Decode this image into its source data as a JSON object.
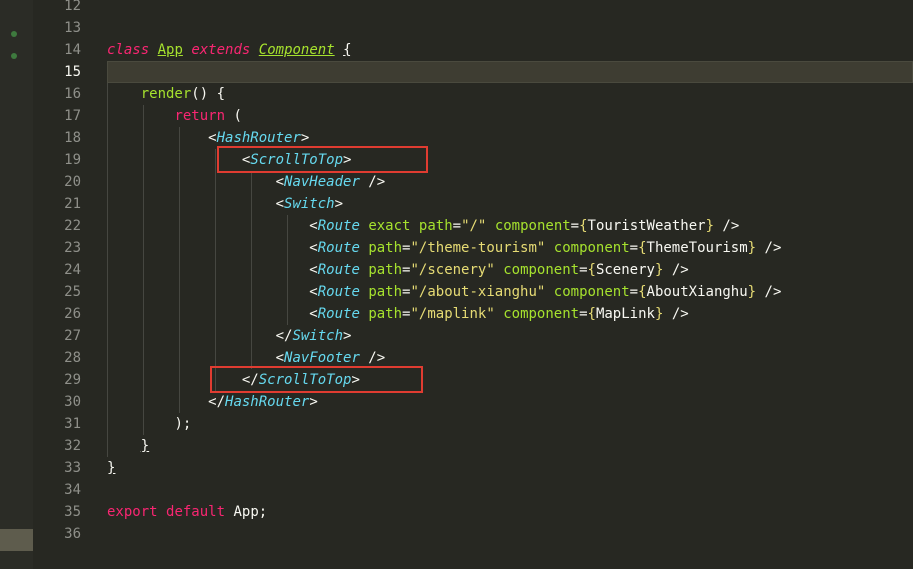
{
  "editor": {
    "theme_colors": {
      "background": "#272822",
      "keyword": "#f92672",
      "tag": "#66d9ef",
      "attribute": "#a6e22e",
      "string": "#e6db74",
      "plain": "#f8f8f2",
      "line_number": "#8f908a",
      "highlight_box": "#e03c31"
    },
    "line_numbers": [
      "12",
      "13",
      "14",
      "15",
      "16",
      "17",
      "18",
      "19",
      "20",
      "21",
      "22",
      "23",
      "24",
      "25",
      "26",
      "27",
      "28",
      "29",
      "30",
      "31",
      "32",
      "33",
      "34",
      "35",
      "36"
    ],
    "active_line": "15",
    "highlighted_lines": [
      "19",
      "29"
    ],
    "code": {
      "l14": {
        "kw_class": "class",
        "name": "App",
        "kw_extends": "extends",
        "parent": "Component",
        "open_brace": "{"
      },
      "l16": {
        "method": "render",
        "tail": "() {"
      },
      "l17": {
        "kw_return": "return",
        "tail": " ("
      },
      "l18": {
        "lt": "<",
        "tag": "HashRouter",
        "gt": ">"
      },
      "l19": {
        "lt": "<",
        "tag": "ScrollToTop",
        "gt": ">"
      },
      "l20": {
        "lt": "<",
        "tag": "NavHeader",
        "gt": " />"
      },
      "l21": {
        "lt": "<",
        "tag": "Switch",
        "gt": ">"
      },
      "l22": {
        "lt": "<",
        "tag": "Route",
        "attr1": "exact",
        "attr2": "path",
        "eq": "=",
        "path": "\"/\"",
        "attr3": "component",
        "ob": "{",
        "comp": "TouristWeather",
        "cb": "}",
        "end": " />"
      },
      "l23": {
        "lt": "<",
        "tag": "Route",
        "attr2": "path",
        "eq": "=",
        "path": "\"/theme-tourism\"",
        "attr3": "component",
        "ob": "{",
        "comp": "ThemeTourism",
        "cb": "}",
        "end": " />"
      },
      "l24": {
        "lt": "<",
        "tag": "Route",
        "attr2": "path",
        "eq": "=",
        "path": "\"/scenery\"",
        "attr3": "component",
        "ob": "{",
        "comp": "Scenery",
        "cb": "}",
        "end": " />"
      },
      "l25": {
        "lt": "<",
        "tag": "Route",
        "attr2": "path",
        "eq": "=",
        "path": "\"/about-xianghu\"",
        "attr3": "component",
        "ob": "{",
        "comp": "AboutXianghu",
        "cb": "}",
        "end": " />"
      },
      "l26": {
        "lt": "<",
        "tag": "Route",
        "attr2": "path",
        "eq": "=",
        "path": "\"/maplink\"",
        "attr3": "component",
        "ob": "{",
        "comp": "MapLink",
        "cb": "}",
        "end": " />"
      },
      "l27": {
        "lt": "</",
        "tag": "Switch",
        "gt": ">"
      },
      "l28": {
        "lt": "<",
        "tag": "NavFooter",
        "gt": " />"
      },
      "l29": {
        "lt": "</",
        "tag": "ScrollToTop",
        "gt": ">"
      },
      "l30": {
        "lt": "</",
        "tag": "HashRouter",
        "gt": ">"
      },
      "l31": {
        "text": ");"
      },
      "l32": {
        "text": "}"
      },
      "l33": {
        "text": "}"
      },
      "l35": {
        "kw_export": "export",
        "kw_default": "default",
        "name": "App",
        "semi": ";"
      }
    }
  }
}
